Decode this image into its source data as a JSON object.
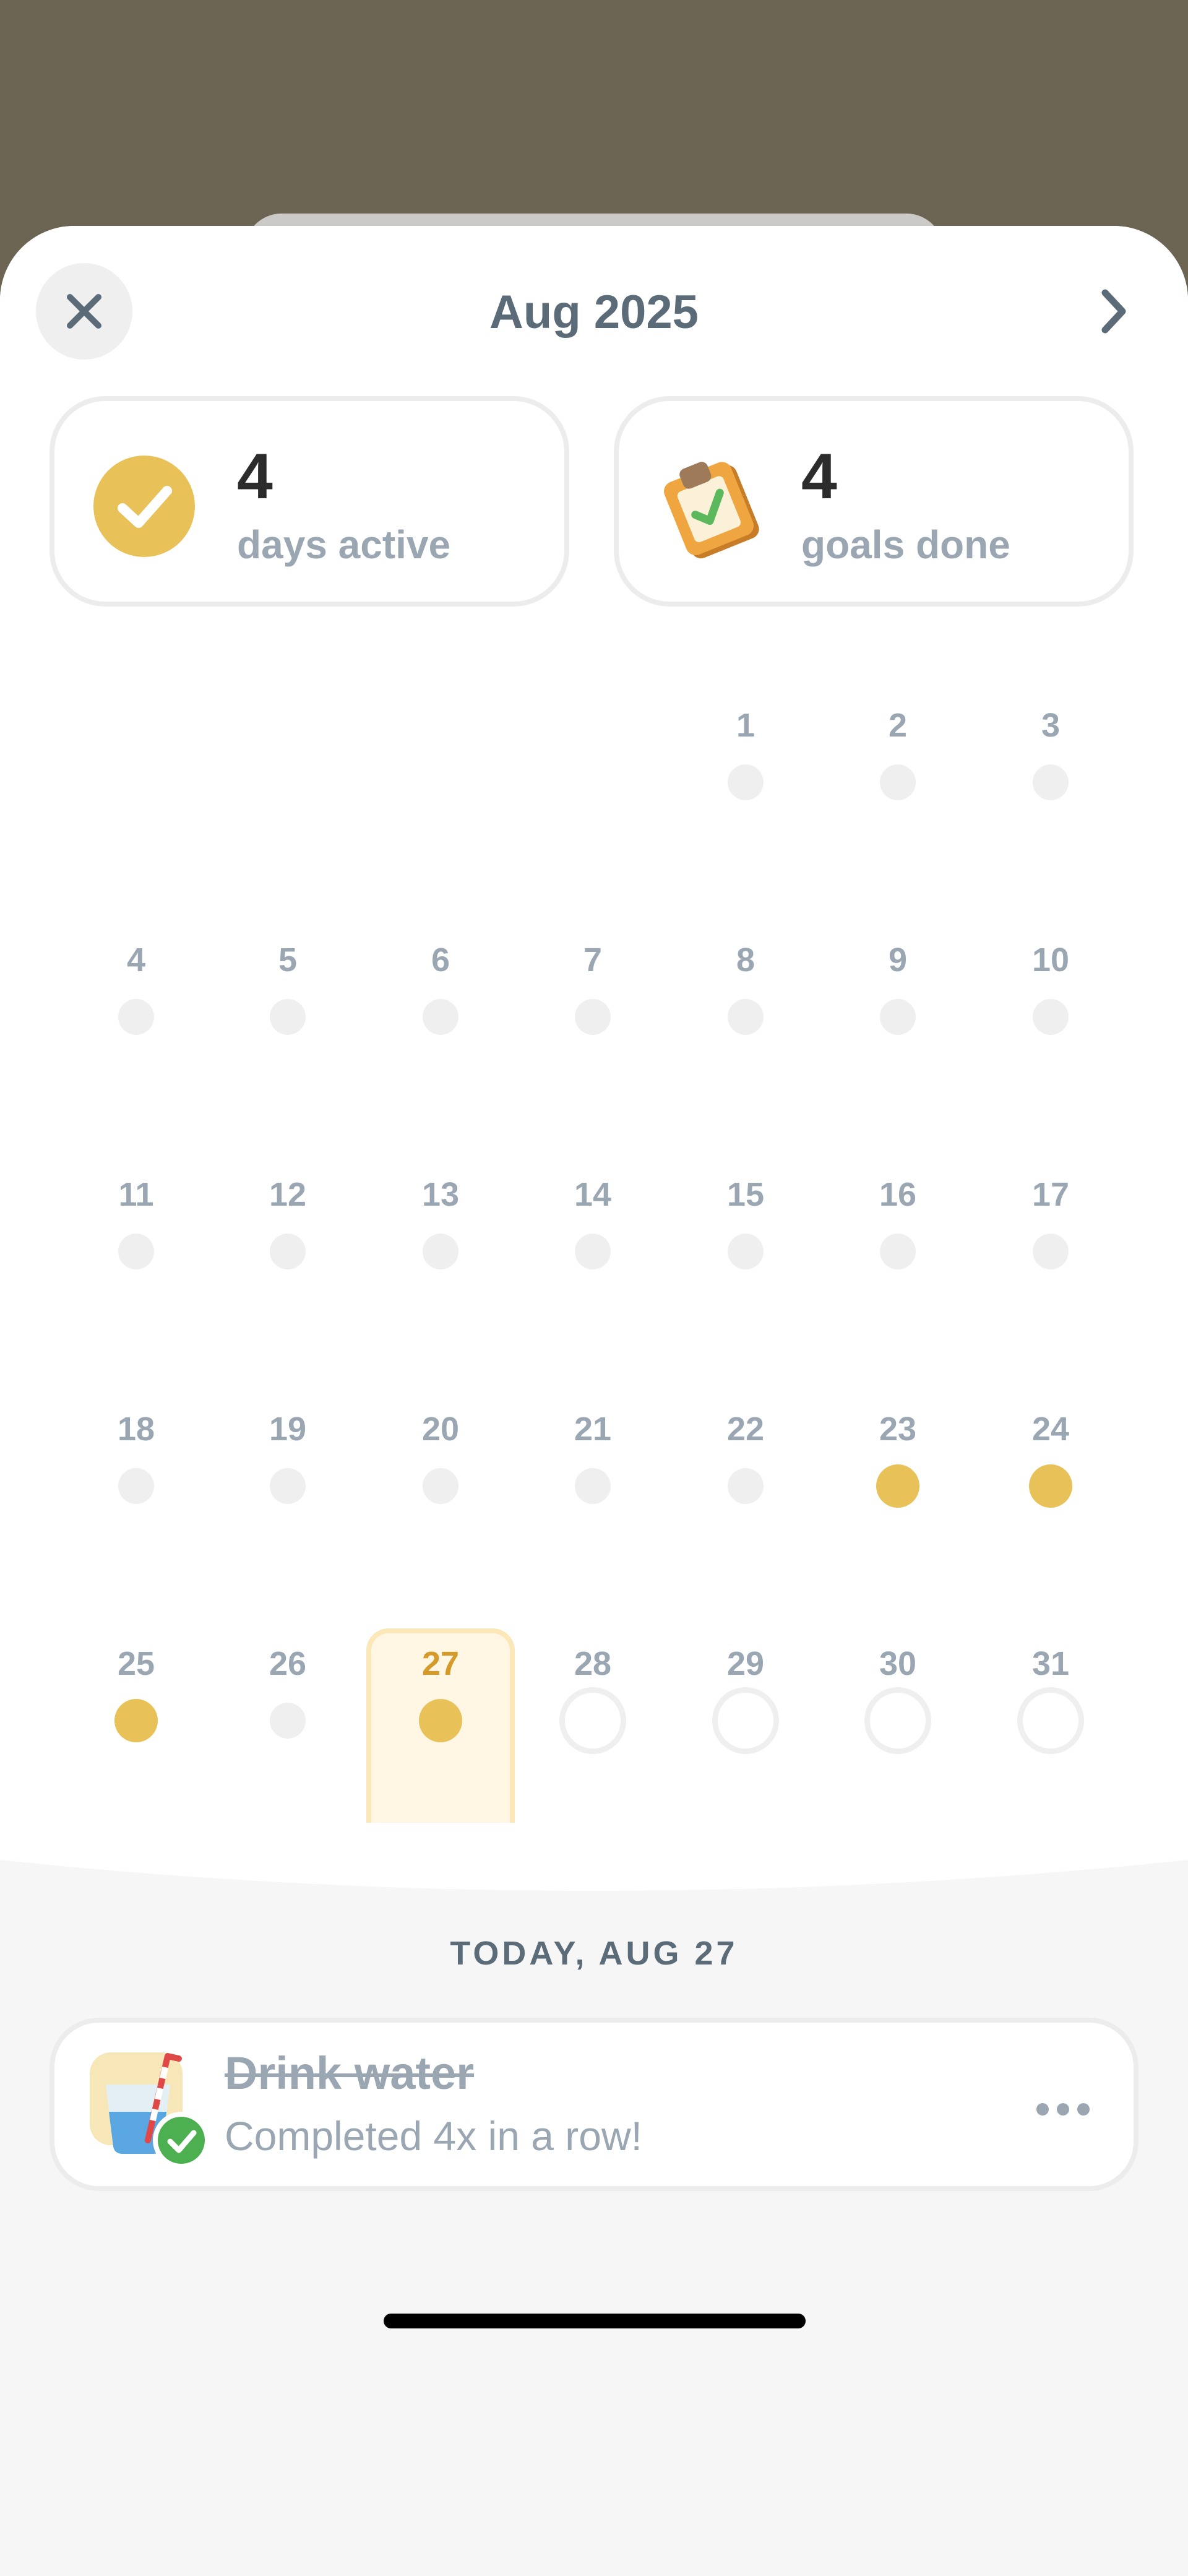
{
  "header": {
    "month_title": "Aug 2025"
  },
  "stats": {
    "days_active": {
      "value": "4",
      "label": "days active",
      "icon": "checkmark-circle-icon"
    },
    "goals_done": {
      "value": "4",
      "label": "goals done",
      "icon": "clipboard-check-icon"
    }
  },
  "calendar": {
    "days": [
      {
        "label": "1",
        "status": "inactive"
      },
      {
        "label": "2",
        "status": "inactive"
      },
      {
        "label": "3",
        "status": "inactive"
      },
      {
        "label": "4",
        "status": "inactive"
      },
      {
        "label": "5",
        "status": "inactive"
      },
      {
        "label": "6",
        "status": "inactive"
      },
      {
        "label": "7",
        "status": "inactive"
      },
      {
        "label": "8",
        "status": "inactive"
      },
      {
        "label": "9",
        "status": "inactive"
      },
      {
        "label": "10",
        "status": "inactive"
      },
      {
        "label": "11",
        "status": "inactive"
      },
      {
        "label": "12",
        "status": "inactive"
      },
      {
        "label": "13",
        "status": "inactive"
      },
      {
        "label": "14",
        "status": "inactive"
      },
      {
        "label": "15",
        "status": "inactive"
      },
      {
        "label": "16",
        "status": "inactive"
      },
      {
        "label": "17",
        "status": "inactive"
      },
      {
        "label": "18",
        "status": "inactive"
      },
      {
        "label": "19",
        "status": "inactive"
      },
      {
        "label": "20",
        "status": "inactive"
      },
      {
        "label": "21",
        "status": "inactive"
      },
      {
        "label": "22",
        "status": "inactive"
      },
      {
        "label": "23",
        "status": "active"
      },
      {
        "label": "24",
        "status": "active"
      },
      {
        "label": "25",
        "status": "active"
      },
      {
        "label": "26",
        "status": "inactive"
      },
      {
        "label": "27",
        "status": "active",
        "today": true
      },
      {
        "label": "28",
        "status": "future"
      },
      {
        "label": "29",
        "status": "future"
      },
      {
        "label": "30",
        "status": "future"
      },
      {
        "label": "31",
        "status": "future"
      }
    ]
  },
  "today_section": {
    "header": "TODAY, AUG 27",
    "goal": {
      "title": "Drink water",
      "subtitle": "Completed 4x in a row!",
      "icon": "water-glass-icon",
      "completed": true
    }
  },
  "colors": {
    "active_dot": "#e8c158",
    "today_text": "#d59a2a",
    "muted_text": "#9aa7b2",
    "title_text": "#5b6b78",
    "success": "#4caf50"
  }
}
